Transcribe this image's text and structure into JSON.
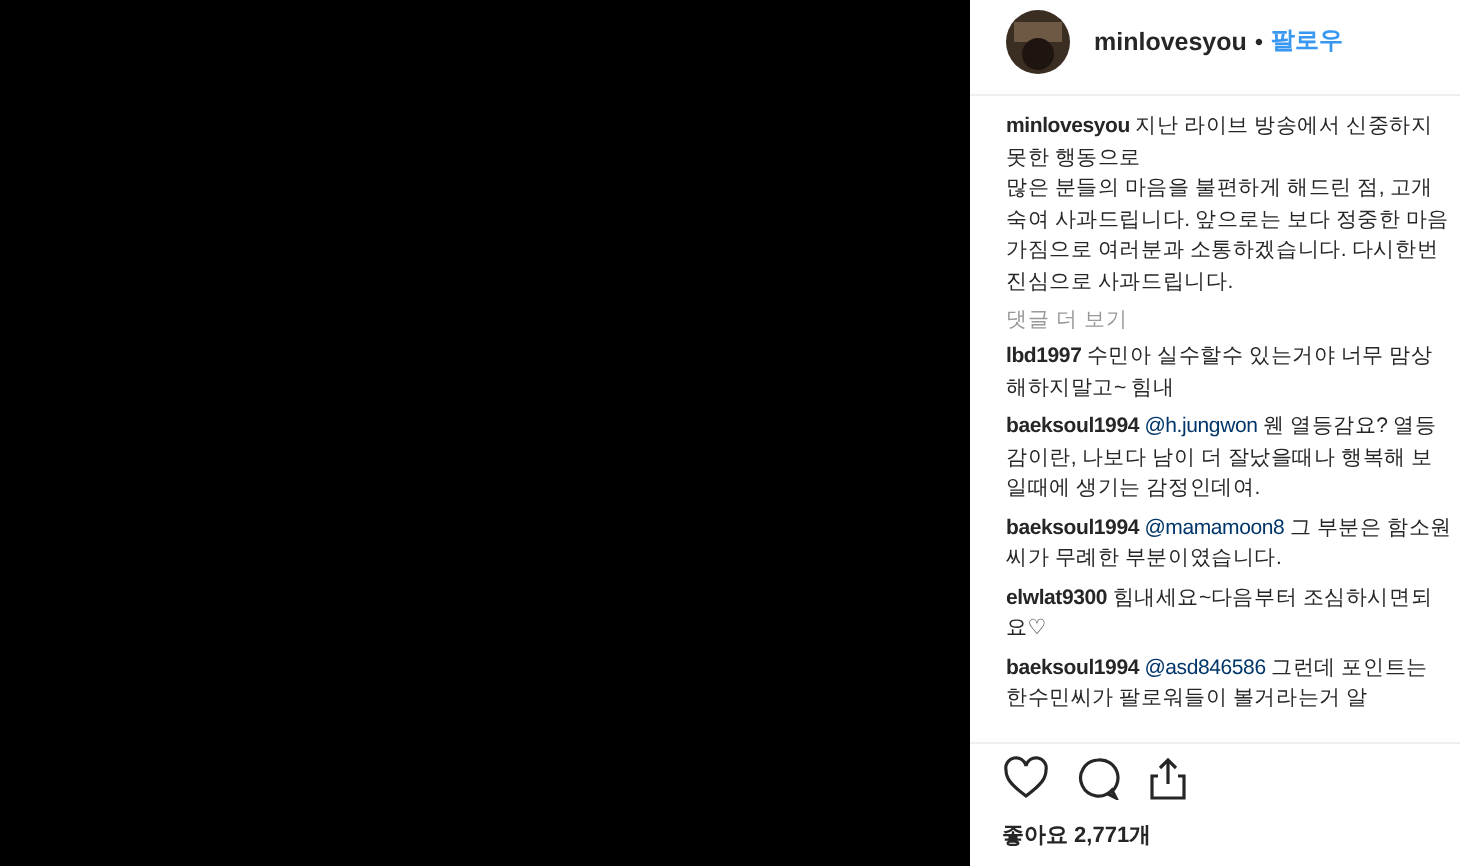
{
  "header": {
    "username": "minlovesyou",
    "separator": "•",
    "follow": "팔로우"
  },
  "caption": {
    "user": "minlovesyou",
    "text": "지난 라이브 방송에서 신중하지 못한 행동으로\n많은 분들의 마음을 불편하게 해드린 점, 고개숙여 사과드립니다. 앞으로는 보다 정중한 마음가짐으로 여러분과 소통하겠습니다. 다시한번 진심으로 사과드립니다."
  },
  "more_comments": "댓글 더 보기",
  "comments": [
    {
      "user": "lbd1997",
      "text": "수민아 실수할수 있는거야 너무 맘상해하지말고~ 힘내"
    },
    {
      "user": "baeksoul1994",
      "mention": "@h.jungwon",
      "text": "웬 열등감요? 열등감이란, 나보다 남이 더 잘났을때나 행복해 보일때에 생기는 감정인데여."
    },
    {
      "user": "baeksoul1994",
      "mention": "@mamamoon8",
      "text": "그 부분은 함소원씨가 무례한 부분이였습니다."
    },
    {
      "user": "elwlat9300",
      "text": "힘내세요~다음부터 조심하시면되요♡"
    },
    {
      "user": "baeksoul1994",
      "mention": "@asd846586",
      "text": "그런데 포인트는 한수민씨가 팔로워들이 볼거라는거 알"
    }
  ],
  "likes": "좋아요 2,771개"
}
